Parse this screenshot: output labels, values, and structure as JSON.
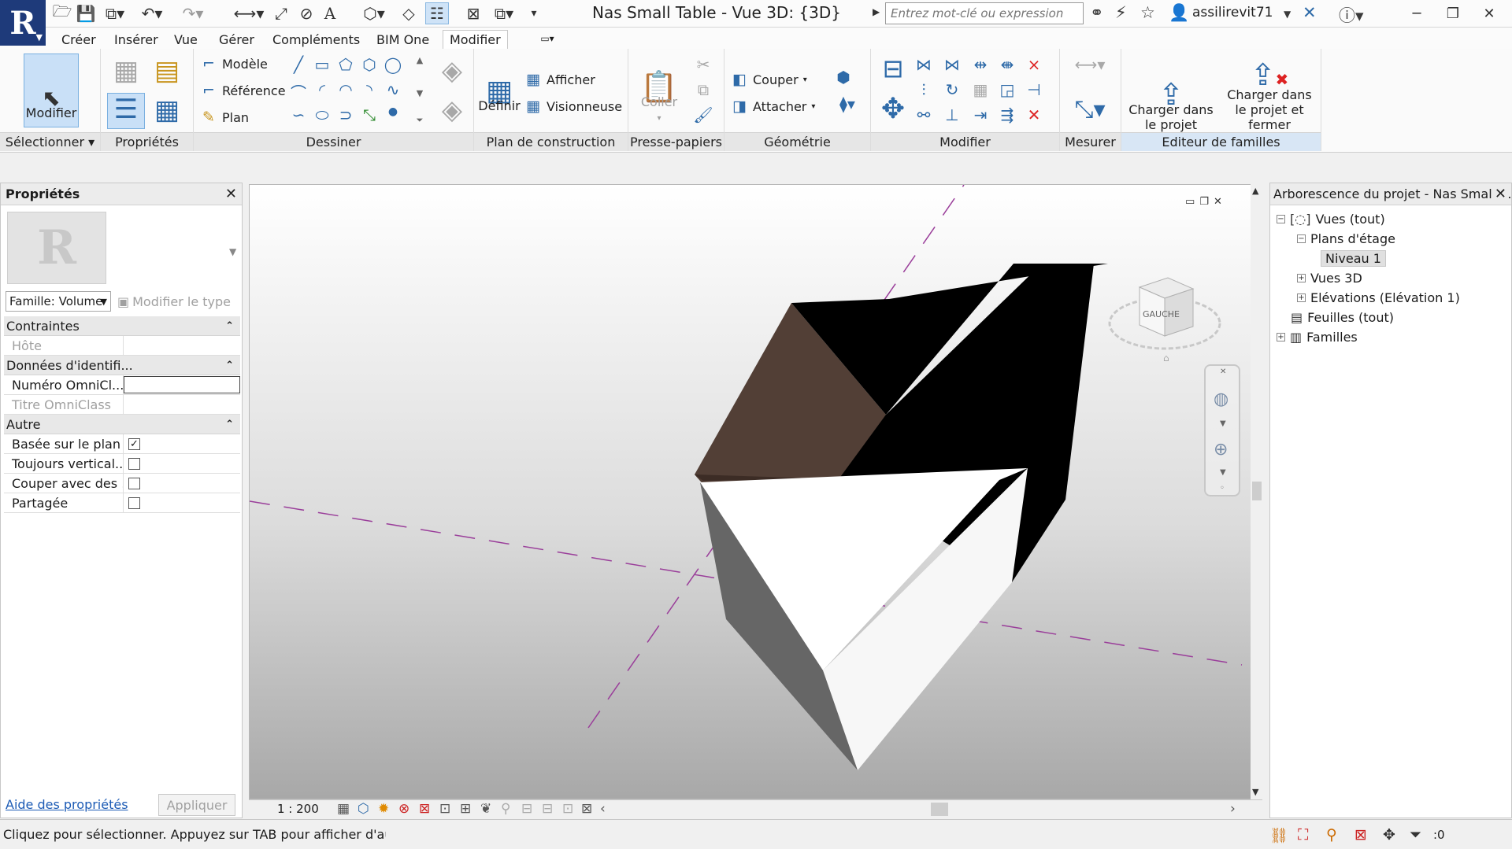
{
  "app": {
    "logo": "R",
    "document_title": "Nas Small Table - Vue 3D: {3D}",
    "search_placeholder": "Entrez mot-clé ou expression",
    "user_name": "assilirevit71"
  },
  "ribbon_tabs": [
    {
      "label": "Créer"
    },
    {
      "label": "Insérer"
    },
    {
      "label": "Vue"
    },
    {
      "label": "Gérer"
    },
    {
      "label": "Compléments"
    },
    {
      "label": "BIM One"
    },
    {
      "label": "Modifier",
      "active": true
    }
  ],
  "ribbon": {
    "panels": {
      "selectionner": "Sélectionner",
      "proprietes": "Propriétés",
      "dessiner": "Dessiner",
      "plan_construction": "Plan de construction",
      "presse_papiers": "Presse-papiers",
      "geometrie": "Géométrie",
      "modifier": "Modifier",
      "mesurer": "Mesurer",
      "editeur_familles": "Editeur de familles"
    },
    "modifier_button": "Modifier",
    "dessiner": {
      "modele": "Modèle",
      "reference": "Référence",
      "plan": "Plan"
    },
    "plan_construction": {
      "definir": "Définir",
      "afficher": "Afficher",
      "visionneuse": "Visionneuse"
    },
    "presse_papiers": {
      "coller": "Coller"
    },
    "geometrie": {
      "couper": "Couper",
      "attacher": "Attacher"
    },
    "editeur": {
      "charger_line1": "Charger dans",
      "charger_line2": "le projet",
      "charger_fermer_line1": "Charger dans",
      "charger_fermer_line2": "le projet et fermer"
    }
  },
  "properties": {
    "title": "Propriétés",
    "family_select": "Famille: Volume",
    "edit_type": "Modifier le type",
    "groups": [
      {
        "name": "Contraintes",
        "rows": [
          {
            "name": "Hôte",
            "value": "",
            "disabled": true
          }
        ]
      },
      {
        "name": "Données d'identifi...",
        "rows": [
          {
            "name": "Numéro OmniCl...",
            "value": "",
            "editing": true
          },
          {
            "name": "Titre OmniClass",
            "value": "",
            "disabled": true
          }
        ]
      },
      {
        "name": "Autre",
        "rows": [
          {
            "name": "Basée sur le plan ...",
            "checkbox": true,
            "checked": true
          },
          {
            "name": "Toujours vertical...",
            "checkbox": true,
            "checked": false
          },
          {
            "name": "Couper avec des ...",
            "checkbox": true,
            "checked": false
          },
          {
            "name": "Partagée",
            "checkbox": true,
            "checked": false
          }
        ]
      }
    ],
    "help_link": "Aide des propriétés",
    "apply_button": "Appliquer"
  },
  "viewport": {
    "viewcube_face": "GAUCHE",
    "scale": "1 : 200",
    "model_colors": {
      "top_face": "#523f36",
      "side_face": "#000000",
      "end_face": "#ffffff",
      "front_face": "#666666",
      "edge_face": "#3c2c25"
    },
    "reference_line_color": "#9a3e9a"
  },
  "project_browser": {
    "title": "Arborescence du projet - Nas Small ...",
    "items": [
      {
        "label": "Vues (tout)",
        "level": 0,
        "toggle": "−",
        "icon": "views-icon"
      },
      {
        "label": "Plans d'étage",
        "level": 1,
        "toggle": "−"
      },
      {
        "label": "Niveau 1",
        "level": 2,
        "selected": true
      },
      {
        "label": "Vues 3D",
        "level": 1,
        "toggle": "+"
      },
      {
        "label": "Elévations (Elévation 1)",
        "level": 1,
        "toggle": "+"
      },
      {
        "label": "Feuilles (tout)",
        "level": 0,
        "icon": "sheets-icon"
      },
      {
        "label": "Familles",
        "level": 0,
        "toggle": "+",
        "icon": "families-icon"
      }
    ]
  },
  "status": {
    "message": "Cliquez pour sélectionner. Appuyez sur TAB pour afficher d'autres",
    "filter_count": ":0"
  }
}
